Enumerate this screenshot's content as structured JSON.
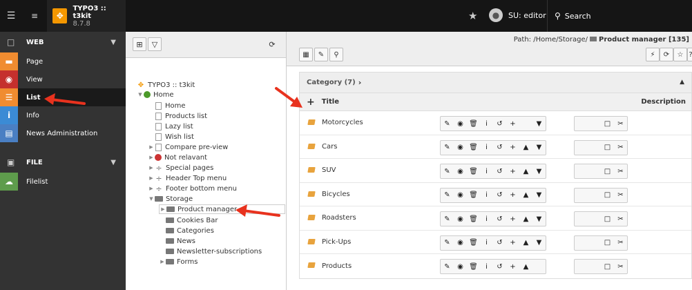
{
  "topbar": {
    "site_name": "TYPO3 :: t3kit",
    "version": "8.7.8",
    "user_label": "SU: editor",
    "search_label": "Search"
  },
  "modules": {
    "web_group": "WEB",
    "web_items": [
      {
        "label": "Page",
        "icon": "page-module-icon",
        "color": "#f08c30"
      },
      {
        "label": "View",
        "icon": "view-module-icon",
        "color": "#c5302d"
      },
      {
        "label": "List",
        "icon": "list-module-icon",
        "color": "#f08c30",
        "active": true
      },
      {
        "label": "Info",
        "icon": "info-module-icon",
        "color": "#3b8bd5"
      },
      {
        "label": "News Administration",
        "icon": "news-module-icon",
        "color": "#4a7fc3"
      }
    ],
    "file_group": "FILE",
    "file_items": [
      {
        "label": "Filelist",
        "icon": "filelist-module-icon",
        "color": "#5e9c4c"
      }
    ]
  },
  "tree": {
    "root": "TYPO3 :: t3kit",
    "nodes": [
      "Home",
      "Home",
      "Products list",
      "Lazy list",
      "Wish list",
      "Compare pre-view",
      "Not relavant",
      "Special pages",
      "Header Top menu",
      "Footer bottom menu",
      "Storage",
      "Product manager",
      "Cookies Bar",
      "Categories",
      "News",
      "Newsletter-subscriptions",
      "Forms"
    ]
  },
  "docheader": {
    "path_prefix": "Path: /Home/Storage/",
    "path_current": "Product manager [135]"
  },
  "table": {
    "header_title": "Category (7)",
    "col_title": "Title",
    "col_description": "Description",
    "rows": [
      "Motorcycles",
      "Cars",
      "SUV",
      "Bicycles",
      "Roadsters",
      "Pick-Ups",
      "Products"
    ]
  }
}
